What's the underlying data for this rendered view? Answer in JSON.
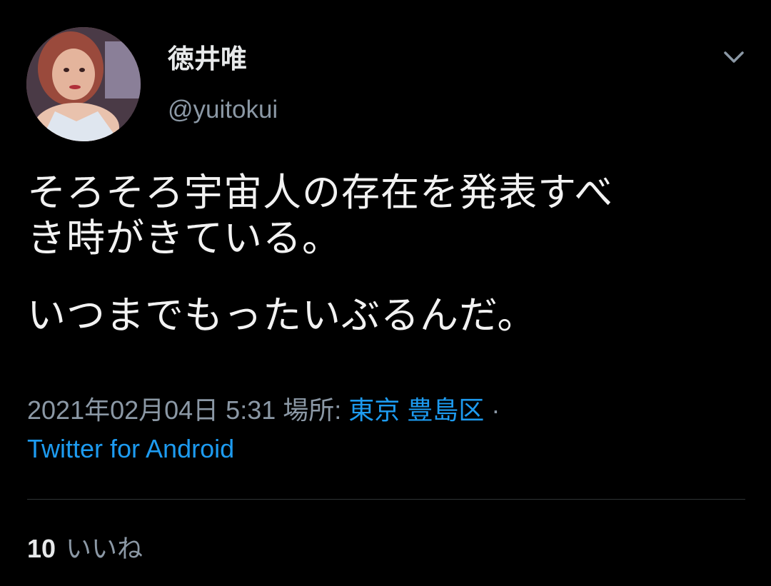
{
  "author": {
    "display_name": "徳井唯",
    "handle": "@yuitokui"
  },
  "menu": {
    "icon": "chevron-down-icon"
  },
  "tweet": {
    "lines": [
      "そろそろ宇宙人の存在を発表すべ",
      "き時がきている。",
      "いつまでもったいぶるんだ。"
    ]
  },
  "meta": {
    "timestamp": "2021年02月04日 5:31",
    "location_label": "場所:",
    "location": "東京 豊島区",
    "separator": "·",
    "source": "Twitter for Android"
  },
  "stats": {
    "likes_count": "10",
    "likes_label": "いいね"
  },
  "colors": {
    "background": "#000000",
    "link": "#1d9bf0",
    "secondary_text": "#8b98a5",
    "divider": "#2f3336"
  }
}
